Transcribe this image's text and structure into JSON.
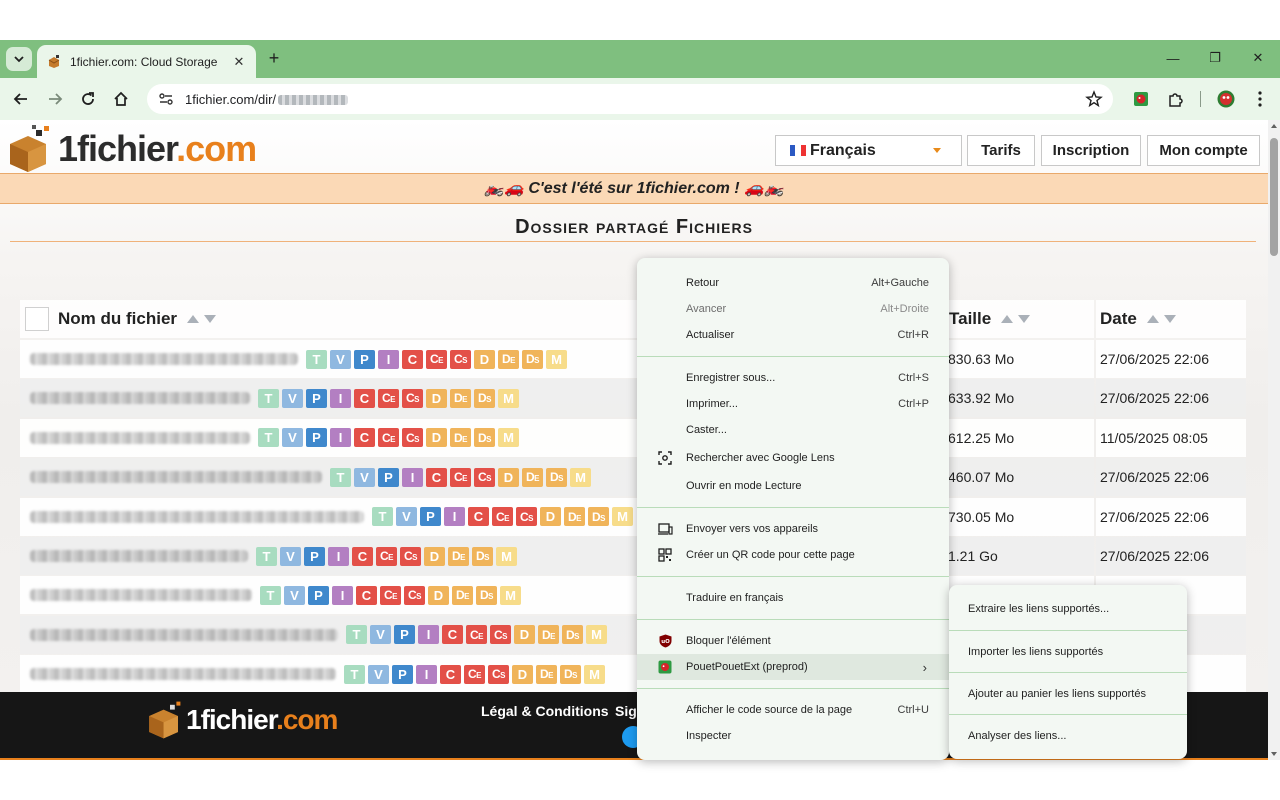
{
  "browser": {
    "tab_title": "1fichier.com: Cloud Storage",
    "tab_close": "✕",
    "new_tab": "+",
    "url": "1fichier.com/dir/",
    "window_controls": {
      "minimize": "—",
      "maximize": "❐",
      "close": "✕"
    }
  },
  "header": {
    "logo_part1": "1fichier",
    "logo_part2": ".com",
    "language": "Français",
    "buttons": {
      "tarifs": "Tarifs",
      "inscription": "Inscription",
      "mon_compte": "Mon compte"
    }
  },
  "banner": {
    "text": "🏍️🚗 C'est l'été sur 1fichier.com ! 🚗🏍️"
  },
  "page_title": "Dossier partagé Fichiers",
  "table": {
    "headers": {
      "name": "Nom du fichier",
      "size": "Taille",
      "date": "Date"
    },
    "badges": [
      "T",
      "V",
      "P",
      "I",
      "C",
      "CE",
      "CS",
      "D",
      "DE",
      "DS",
      "M"
    ],
    "badge_colors": [
      "#a8dcc0",
      "#8fb8e0",
      "#3f88cc",
      "#b37fc2",
      "#e35048",
      "#e35048",
      "#e35048",
      "#f0b45a",
      "#f0b45a",
      "#f0b45a",
      "#f7dc8a"
    ],
    "rows": [
      {
        "size": "830.63 Mo",
        "date": "27/06/2025 22:06"
      },
      {
        "size": "633.92 Mo",
        "date": "27/06/2025 22:06"
      },
      {
        "size": "612.25 Mo",
        "date": "11/05/2025 08:05"
      },
      {
        "size": "460.07 Mo",
        "date": "27/06/2025 22:06"
      },
      {
        "size": "730.05 Mo",
        "date": "27/06/2025 22:06"
      },
      {
        "size": "1.21 Go",
        "date": "27/06/2025 22:06"
      },
      {
        "size": "",
        "date": "2:06"
      },
      {
        "size": "",
        "date": "2:06"
      },
      {
        "size": "",
        "date": "2:06"
      }
    ]
  },
  "footer": {
    "logo_part1": "1fichier",
    "logo_part2": ".com",
    "legal": "Légal & Conditions",
    "partial": "Sign"
  },
  "context_menu": {
    "back": {
      "label": "Retour",
      "shortcut": "Alt+Gauche"
    },
    "forward": {
      "label": "Avancer",
      "shortcut": "Alt+Droite"
    },
    "reload": {
      "label": "Actualiser",
      "shortcut": "Ctrl+R"
    },
    "save_as": {
      "label": "Enregistrer sous...",
      "shortcut": "Ctrl+S"
    },
    "print": {
      "label": "Imprimer...",
      "shortcut": "Ctrl+P"
    },
    "cast": {
      "label": "Caster..."
    },
    "lens": {
      "label": "Rechercher avec Google Lens"
    },
    "reader": {
      "label": "Ouvrir en mode Lecture"
    },
    "send_devices": {
      "label": "Envoyer vers vos appareils"
    },
    "qr": {
      "label": "Créer un QR code pour cette page"
    },
    "translate": {
      "label": "Traduire en français"
    },
    "block": {
      "label": "Bloquer l'élément"
    },
    "pouet": {
      "label": "PouetPouetExt (preprod)"
    },
    "view_source": {
      "label": "Afficher le code source de la page",
      "shortcut": "Ctrl+U"
    },
    "inspect": {
      "label": "Inspecter"
    }
  },
  "submenu": {
    "extract": "Extraire les liens supportés...",
    "import": "Importer les liens supportés",
    "cart": "Ajouter au panier les liens supportés",
    "analyze": "Analyser des liens..."
  }
}
